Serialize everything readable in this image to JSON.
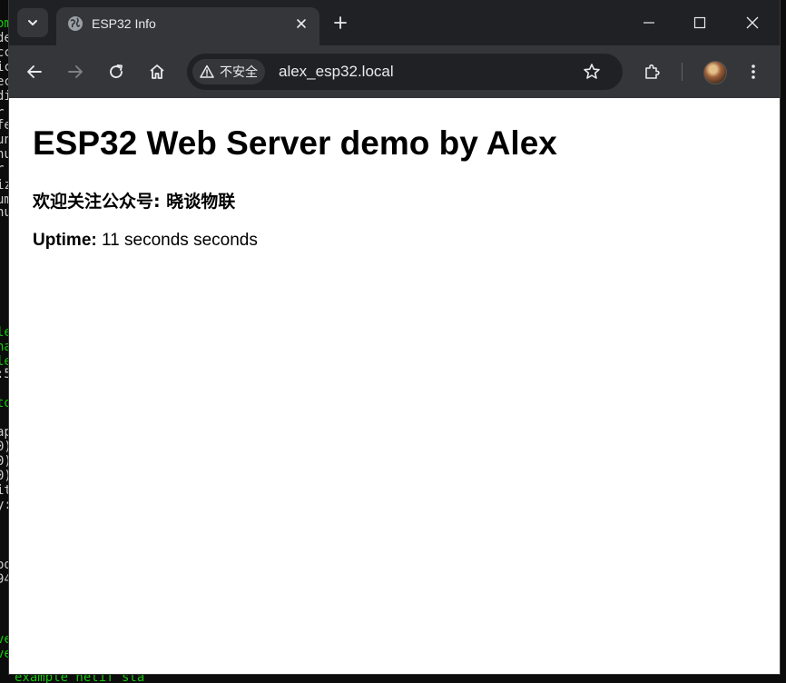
{
  "background_terminal": {
    "lines": [
      {
        "text": "om",
        "color": "green"
      },
      {
        "text": "de",
        "color": "gray"
      },
      {
        "text": "cc",
        "color": "gray"
      },
      {
        "text": "ic",
        "color": "gray"
      },
      {
        "text": "ec",
        "color": "gray"
      },
      {
        "text": "di",
        "color": "gray"
      },
      {
        "text": "r",
        "color": "gray"
      },
      {
        "text": "fe",
        "color": "gray"
      },
      {
        "text": "un",
        "color": "gray"
      },
      {
        "text": "nu",
        "color": "gray"
      },
      {
        "text": "r",
        "color": "gray"
      },
      {
        "text": "iz",
        "color": "gray"
      },
      {
        "text": "um",
        "color": "gray"
      },
      {
        "text": "nu",
        "color": "gray"
      },
      {
        "text": "le",
        "color": "green"
      },
      {
        "text": "na",
        "color": "green"
      },
      {
        "text": "le",
        "color": "green"
      },
      {
        "text": ":5",
        "color": "gray"
      },
      {
        "text": "to",
        "color": "green"
      },
      {
        "text": "ap",
        "color": "gray"
      },
      {
        "text": "0)",
        "color": "gray"
      },
      {
        "text": "0)",
        "color": "gray"
      },
      {
        "text": "0)",
        "color": "gray"
      },
      {
        "text": "it",
        "color": "gray"
      },
      {
        "text": "y:",
        "color": "gray"
      },
      {
        "text": "od",
        "color": "gray"
      },
      {
        "text": "94",
        "color": "gray"
      },
      {
        "text": "ve",
        "color": "green"
      },
      {
        "text": "ve",
        "color": "green"
      },
      {
        "text": "example netif sta",
        "color": "green"
      }
    ]
  },
  "browser": {
    "tab": {
      "title": "ESP32 Info"
    },
    "omnibox": {
      "security_label": "不安全",
      "url": "alex_esp32.local"
    }
  },
  "page": {
    "heading": "ESP32 Web Server demo by Alex",
    "subheading": "欢迎关注公众号: 晓谈物联",
    "uptime_label": "Uptime:",
    "uptime_value": "11 seconds seconds"
  }
}
